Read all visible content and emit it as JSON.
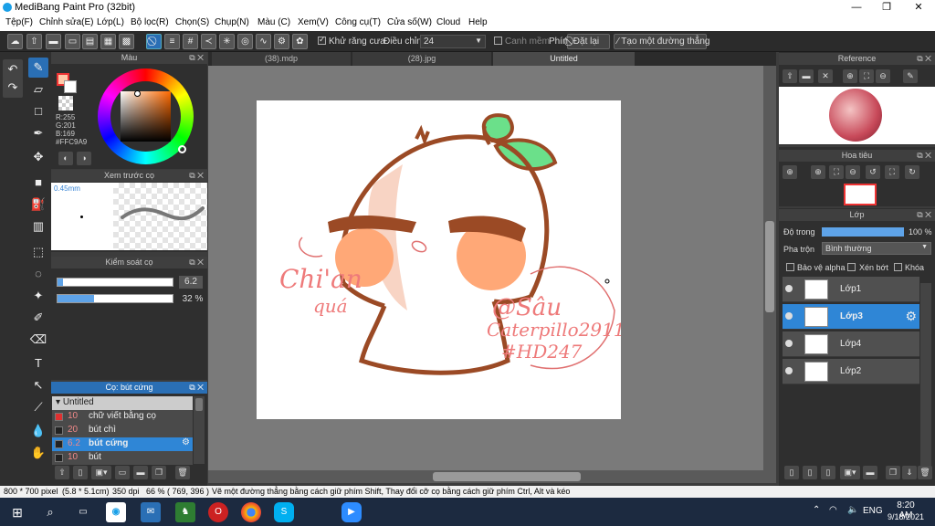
{
  "app": {
    "title": "MediBang Paint Pro (32bit)"
  },
  "window": {
    "minimize": "—",
    "maximize": "❐",
    "close": "✕"
  },
  "menu": [
    "Tệp(F)",
    "Chỉnh sửa(E)",
    "Lớp(L)",
    "Bộ lọc(R)",
    "Chọn(S)",
    "Chụp(N)",
    "Màu (C)",
    "Xem(V)",
    "Công cụ(T)",
    "Cửa số(W)",
    "Cloud",
    "Help"
  ],
  "toolbar": {
    "antialias_label": "Khử răng cưa",
    "adjust_label": "Điều chỉnh",
    "adjust_value": "24",
    "smooth_label": "Canh mềm",
    "key_label": "Phím",
    "reset_label": "Đặt lại",
    "line_label": "Tạo một đường thẳng"
  },
  "color_panel": {
    "title": "Màu",
    "r": "R:255",
    "g": "G:201",
    "b": "B:169",
    "hex": "#FFC9A9"
  },
  "brush_preview": {
    "title": "Xem trước cọ",
    "size": "0.45mm"
  },
  "brush_control": {
    "title": "Kiểm soát cọ",
    "size_value": "6.2",
    "opacity_value": "32 %",
    "size_fraction": 0.05,
    "opacity_fraction": 0.32
  },
  "brush_list": {
    "title": "Cọ: bút cứng",
    "group": "Untitled",
    "items": [
      {
        "size": "10",
        "name": "chữ viết bằng cọ",
        "swatch": "#e03030"
      },
      {
        "size": "20",
        "name": "bút chì",
        "swatch": "#222222"
      },
      {
        "size": "6.2",
        "name": "bút cứng",
        "swatch": "#222222"
      },
      {
        "size": "10",
        "name": "bút",
        "swatch": "#222222"
      }
    ]
  },
  "doc_tabs": [
    "(38).mdp",
    "(28).jpg",
    "Untitled"
  ],
  "reference_panel": {
    "title": "Reference"
  },
  "navigator_panel": {
    "title": "Hoa tiêu"
  },
  "layer_panel": {
    "title": "Lớp",
    "opacity_label": "Độ trong",
    "opacity_value": "100 %",
    "blend_label": "Pha trộn",
    "blend_value": "Bình thường",
    "protect_alpha": "Bảo vệ alpha",
    "clip": "Xén bớt",
    "lock": "Khóa",
    "layers": [
      "Lớp1",
      "Lớp3",
      "Lớp4",
      "Lớp2"
    ]
  },
  "artwork": {
    "text1": "Chi'an",
    "text2": "quá",
    "text3": "@Sâu",
    "text4": "Caterpillo2911",
    "text5": "#HD247"
  },
  "status": {
    "size": "800 * 700 pixel",
    "cm": "(5.8 * 5.1cm)",
    "dpi": "350 dpi",
    "zoom": "66 %",
    "coords": "( 769, 396 )",
    "hint": "Vẽ một đường thẳng bằng cách giữ phím Shift, Thay đổi cỡ cọ bằng cách giữ phím Ctrl, Alt và kéo"
  },
  "taskbar": {
    "lang": "ENG",
    "time": "8:20 AM",
    "date": "9/18/2021"
  },
  "colors": {
    "accent": "#2f86d6",
    "skin": "#FFC9A9",
    "outline": "#9b4a25",
    "leaf": "#6be08a"
  }
}
